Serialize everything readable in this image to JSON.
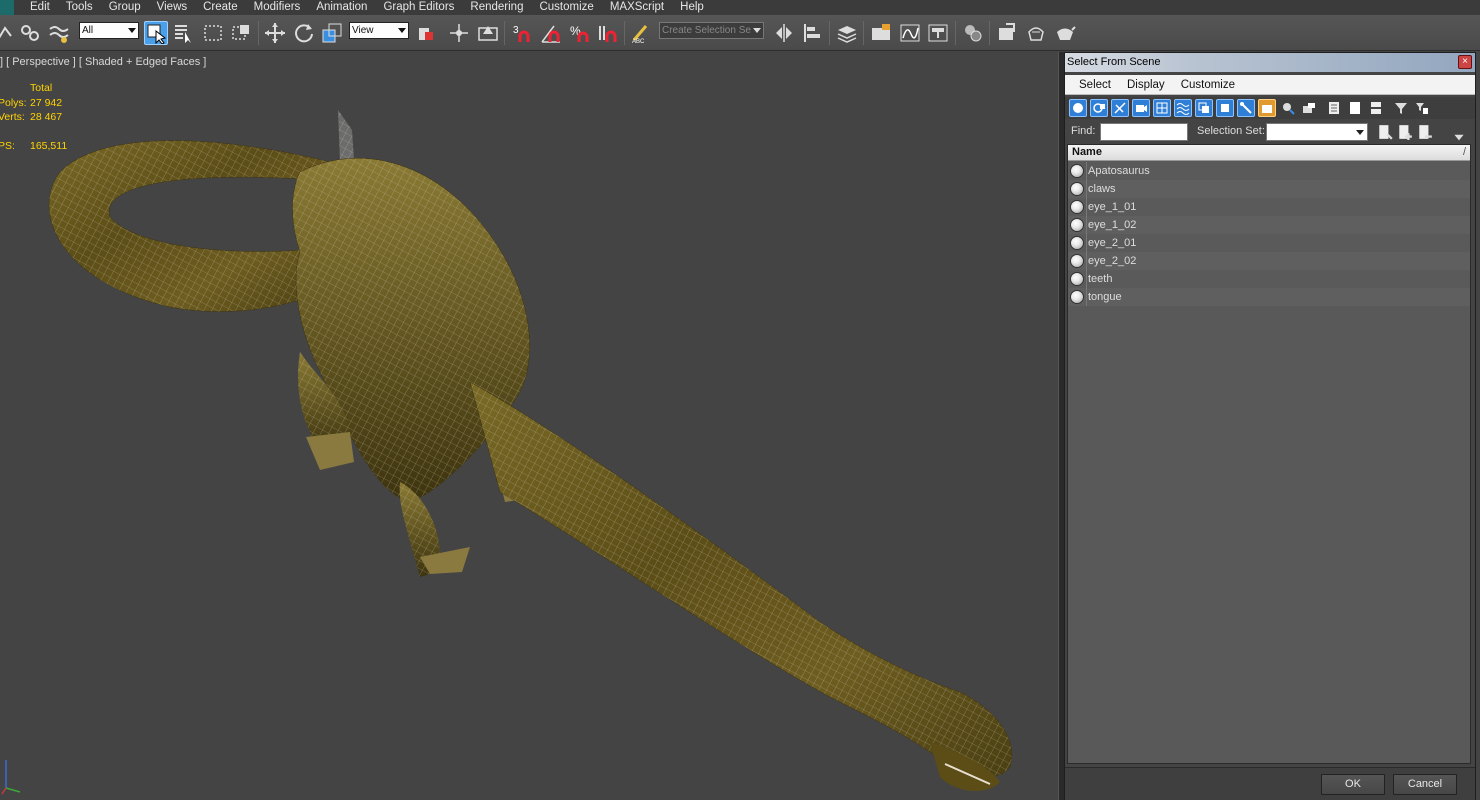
{
  "menubar": {
    "items": [
      "Edit",
      "Tools",
      "Group",
      "Views",
      "Create",
      "Modifiers",
      "Animation",
      "Graph Editors",
      "Rendering",
      "Customize",
      "MAXScript",
      "Help"
    ]
  },
  "toolbar": {
    "selection_filter": "All",
    "reference_coord": "View",
    "named_selection_placeholder": "Create Selection Se"
  },
  "viewport": {
    "label": "] [ Perspective ] [ Shaded + Edged Faces ]",
    "stats": {
      "header": "Total",
      "polys_label": "Polys:",
      "polys_value": "27 942",
      "verts_label": "Verts:",
      "verts_value": "28 467",
      "fps_label": "PS:",
      "fps_value": "165,511"
    }
  },
  "dialog": {
    "title": "Select From Scene",
    "close_glyph": "×",
    "menu": [
      "Select",
      "Display",
      "Customize"
    ],
    "find_label": "Find:",
    "find_value": "",
    "selection_set_label": "Selection Set:",
    "selection_set_value": "",
    "column_header": "Name",
    "sort_glyph": "/",
    "objects": [
      "Apatosaurus",
      "claws",
      "eye_1_01",
      "eye_1_02",
      "eye_2_01",
      "eye_2_02",
      "teeth",
      "tongue"
    ],
    "ok_label": "OK",
    "cancel_label": "Cancel"
  },
  "colors": {
    "accent_blue": "#4aa0e8",
    "viewport_bg": "#444444",
    "stats_yellow": "#ffd400",
    "model_olive": "#6b5a1e",
    "wire": "#d8d8c8"
  }
}
